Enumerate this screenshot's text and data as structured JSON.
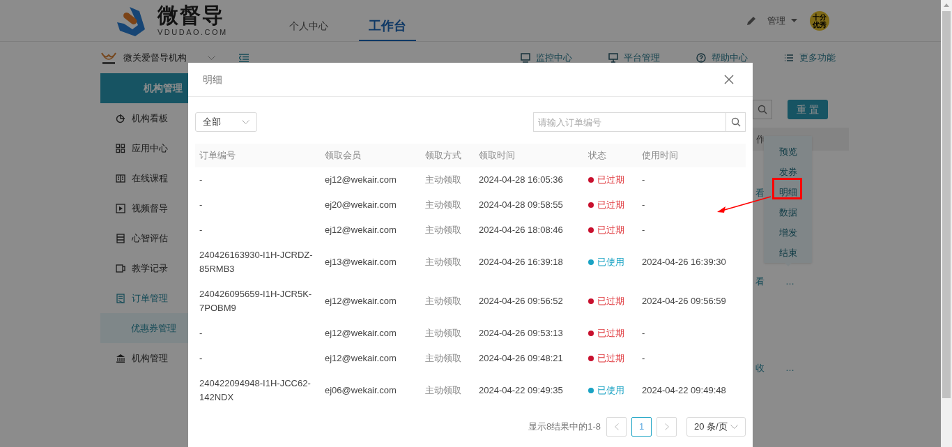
{
  "header": {
    "logo": {
      "name": "微督导",
      "domain": "VDUDAO.COM"
    },
    "nav_tabs": [
      {
        "label": "个人中心",
        "selected": false
      },
      {
        "label": "工作台",
        "selected": true
      }
    ],
    "user_menu": {
      "label": "管理"
    },
    "avatar_badge": {
      "lines": [
        "十分",
        "优秀"
      ]
    }
  },
  "org_bar": {
    "org_name": "微关爱督导机构",
    "links": [
      {
        "kind": "monitor",
        "label": "监控中心"
      },
      {
        "kind": "desktop",
        "label": "平台管理"
      },
      {
        "kind": "help",
        "label": "帮助中心"
      },
      {
        "kind": "list",
        "label": "更多功能"
      }
    ]
  },
  "sidebar": {
    "title": "机构管理",
    "items": [
      {
        "kind": "pie",
        "label": "机构看板",
        "selected": false
      },
      {
        "kind": "grid",
        "label": "应用中心",
        "selected": false
      },
      {
        "kind": "book",
        "label": "在线课程",
        "selected": false
      },
      {
        "kind": "play",
        "label": "视频督导",
        "selected": false
      },
      {
        "kind": "list",
        "label": "心智评估",
        "selected": false
      },
      {
        "kind": "video",
        "label": "教学记录",
        "selected": false
      },
      {
        "kind": "doc",
        "label": "订单管理",
        "selected": true,
        "children": [
          {
            "label": "优惠券管理",
            "selected": true
          }
        ]
      },
      {
        "kind": "bank",
        "label": "机构管理",
        "selected": false
      }
    ]
  },
  "background": {
    "reset_button": "重 置",
    "table_header_fragment": "作",
    "rows": [
      {
        "cell_fragment": "看"
      },
      {
        "cell_fragment": "看",
        "more": "…"
      },
      {
        "cell_fragment": "收",
        "more": "…"
      }
    ]
  },
  "action_menu": {
    "items": [
      {
        "label": "预览",
        "annotated": false
      },
      {
        "label": "发券",
        "annotated": false
      },
      {
        "label": "明细",
        "annotated": true
      },
      {
        "label": "数据",
        "annotated": false
      },
      {
        "label": "增发",
        "annotated": false
      },
      {
        "label": "结束",
        "annotated": false
      }
    ]
  },
  "modal": {
    "title": "明细",
    "filter": {
      "value": "全部"
    },
    "search": {
      "placeholder": "请输入订单编号"
    },
    "columns": [
      "订单编号",
      "领取会员",
      "领取方式",
      "领取时间",
      "状态",
      "使用时间"
    ],
    "rows": [
      {
        "order": "-",
        "member": "ej12@wekair.com",
        "method": "主动领取",
        "time": "2024-04-28 16:05:36",
        "status": {
          "kind": "expired",
          "label": "已过期"
        },
        "used_time": "-"
      },
      {
        "order": "-",
        "member": "ej20@wekair.com",
        "method": "主动领取",
        "time": "2024-04-28 09:58:55",
        "status": {
          "kind": "expired",
          "label": "已过期"
        },
        "used_time": "-"
      },
      {
        "order": "-",
        "member": "ej12@wekair.com",
        "method": "主动领取",
        "time": "2024-04-26 18:08:46",
        "status": {
          "kind": "expired",
          "label": "已过期"
        },
        "used_time": "-"
      },
      {
        "order": "240426163930-I1H-JCRDZ-85RMB3",
        "member": "ej13@wekair.com",
        "method": "主动领取",
        "time": "2024-04-26 16:39:18",
        "status": {
          "kind": "used",
          "label": "已使用"
        },
        "used_time": "2024-04-26 16:39:30"
      },
      {
        "order": "240426095659-I1H-JCR5K-7POBM9",
        "member": "ej12@wekair.com",
        "method": "主动领取",
        "time": "2024-04-26 09:56:52",
        "status": {
          "kind": "expired",
          "label": "已过期"
        },
        "used_time": "2024-04-26 09:56:59"
      },
      {
        "order": "-",
        "member": "ej12@wekair.com",
        "method": "主动领取",
        "time": "2024-04-26 09:53:13",
        "status": {
          "kind": "expired",
          "label": "已过期"
        },
        "used_time": "-"
      },
      {
        "order": "-",
        "member": "ej12@wekair.com",
        "method": "主动领取",
        "time": "2024-04-26 09:48:21",
        "status": {
          "kind": "expired",
          "label": "已过期"
        },
        "used_time": "-"
      },
      {
        "order": "240422094948-I1H-JCC62-142NDX",
        "member": "ej06@wekair.com",
        "method": "主动领取",
        "time": "2024-04-22 09:49:35",
        "status": {
          "kind": "used",
          "label": "已使用"
        },
        "used_time": "2024-04-22 09:49:48"
      }
    ],
    "pagination": {
      "summary": "显示8结果中的1-8",
      "pages": [
        {
          "label": "1",
          "selected": true
        }
      ],
      "page_size": "20 条/页"
    }
  }
}
